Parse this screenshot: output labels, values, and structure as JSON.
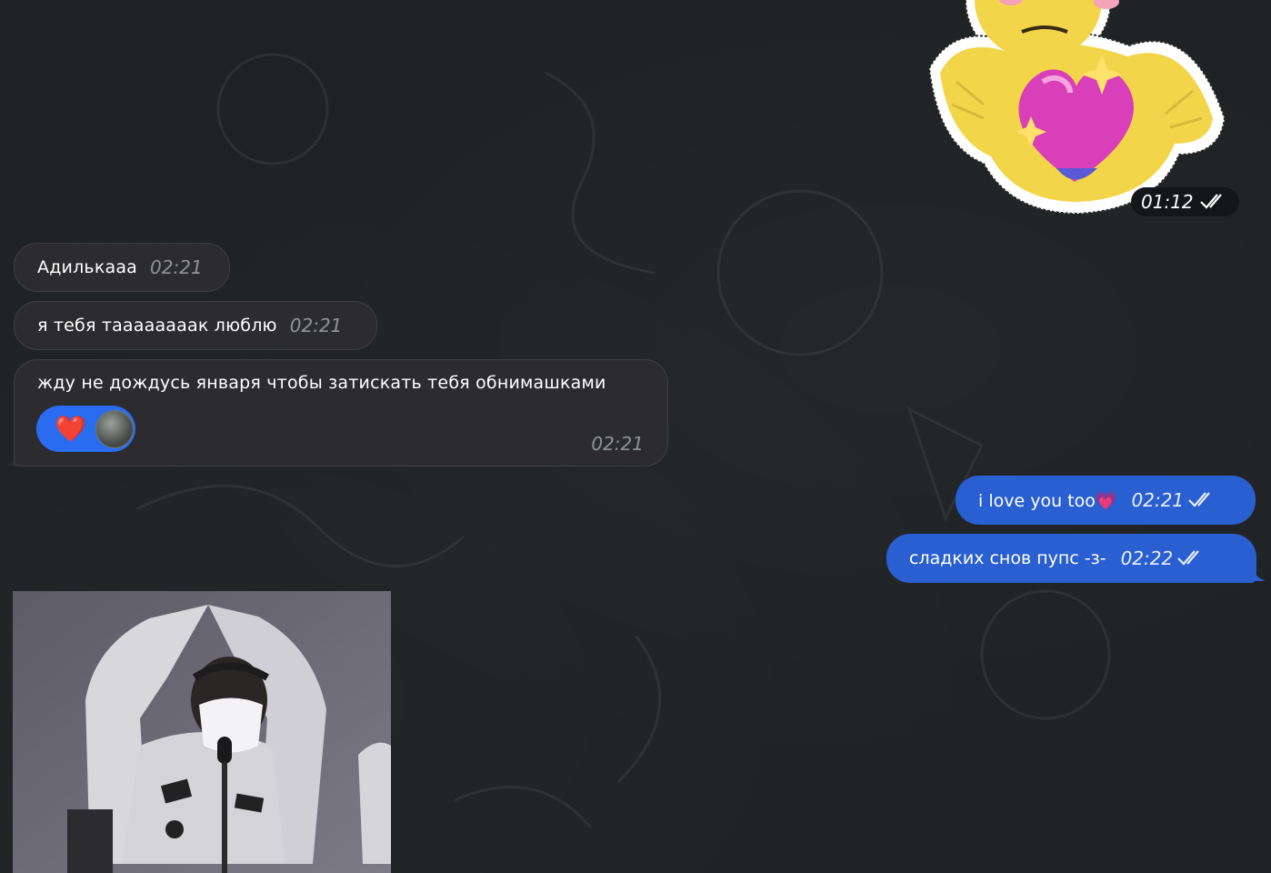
{
  "sticker": {
    "time": "01:12",
    "emoji": "💖"
  },
  "messages_in": [
    {
      "text": "Адилькааа",
      "time": "02:21"
    },
    {
      "text": "я тебя таааааааак люблю",
      "time": "02:21"
    },
    {
      "text": "жду не дождусь января чтобы затискать тебя обнимашками",
      "time": "02:21"
    }
  ],
  "reaction": {
    "emoji": "❤️"
  },
  "messages_out": [
    {
      "text": "i love you too💗",
      "time": "02:21"
    },
    {
      "text": "сладких снов пупс -з-",
      "time": "02:22"
    }
  ],
  "colors": {
    "background": "#1f2224",
    "incoming_bubble": "#2c2c2e",
    "outgoing_bubble": "#2a5fd1",
    "reaction": "#2a6cf0"
  }
}
